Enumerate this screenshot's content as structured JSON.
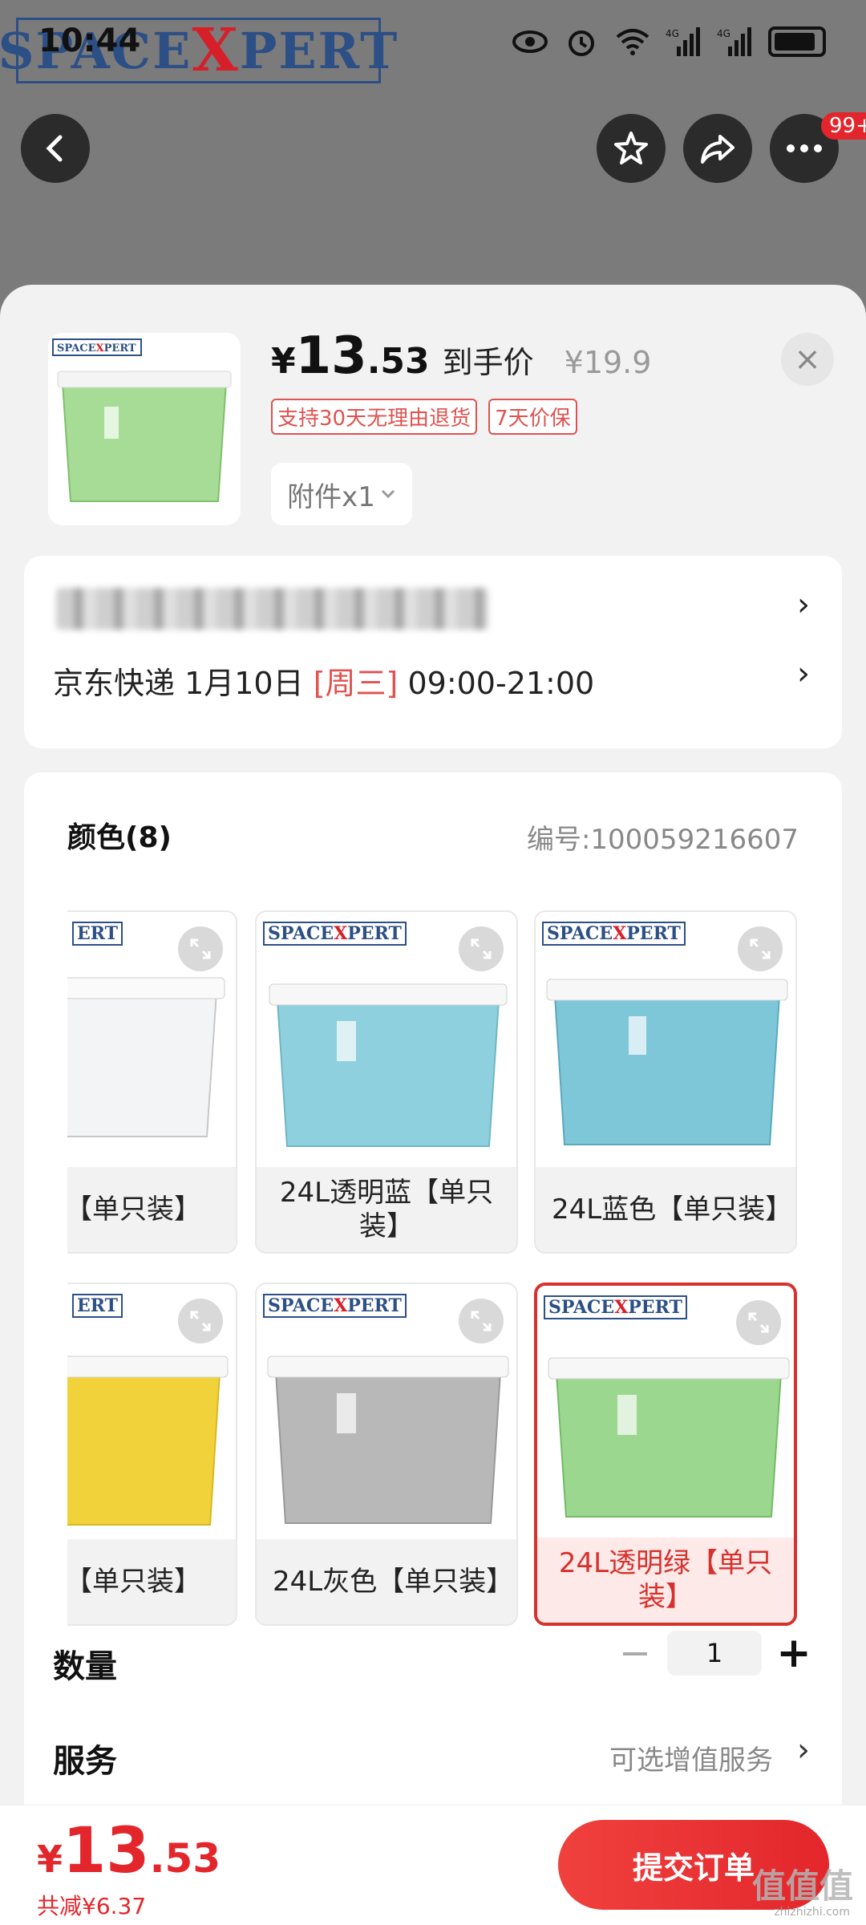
{
  "status_bar": {
    "time": "10:44"
  },
  "brand_logo": {
    "left": "SPACE",
    "x": "X",
    "right": "PERT"
  },
  "top_actions": {
    "badge": "99+"
  },
  "product": {
    "price_currency": "¥",
    "price_int": "13",
    "price_dec": ".53",
    "price_suffix": "到手价",
    "original_price": "¥19.9",
    "tags": [
      "支持30天无理由退货",
      "7天价保"
    ],
    "accessory": "附件x1"
  },
  "delivery": {
    "address": "",
    "carrier_text": "京东快递 1月10日",
    "weekday": "[周三]",
    "time_window": "09:00-21:00"
  },
  "variants": {
    "title": "颜色(8)",
    "sku": "编号:100059216607",
    "items": [
      {
        "label": "高透【单只装】",
        "color": "#f2f4f5"
      },
      {
        "label": "24L透明蓝【单只装】",
        "color": "#8fd0de"
      },
      {
        "label": "24L蓝色【单只装】",
        "color": "#7ec7d9"
      },
      {
        "label": "黄色【单只装】",
        "color": "#f2d23b"
      },
      {
        "label": "24L灰色【单只装】",
        "color": "#b8b8b8"
      },
      {
        "label": "24L透明绿【单只装】",
        "color": "#9bd78f",
        "selected": true
      }
    ]
  },
  "quantity": {
    "label": "数量",
    "value": "1",
    "minus": "−",
    "plus": "+"
  },
  "service": {
    "label": "服务",
    "value": "可选增值服务"
  },
  "bottom": {
    "total_currency": "¥",
    "total_int": "13",
    "total_dec": ".53",
    "saved": "共减¥6.37",
    "submit": "提交订单"
  },
  "watermark": {
    "main": "值值值",
    "sub": "zhizhizhi.com"
  },
  "colors": {
    "accent": "#e3262b",
    "brand_blue": "#2c4f86"
  }
}
